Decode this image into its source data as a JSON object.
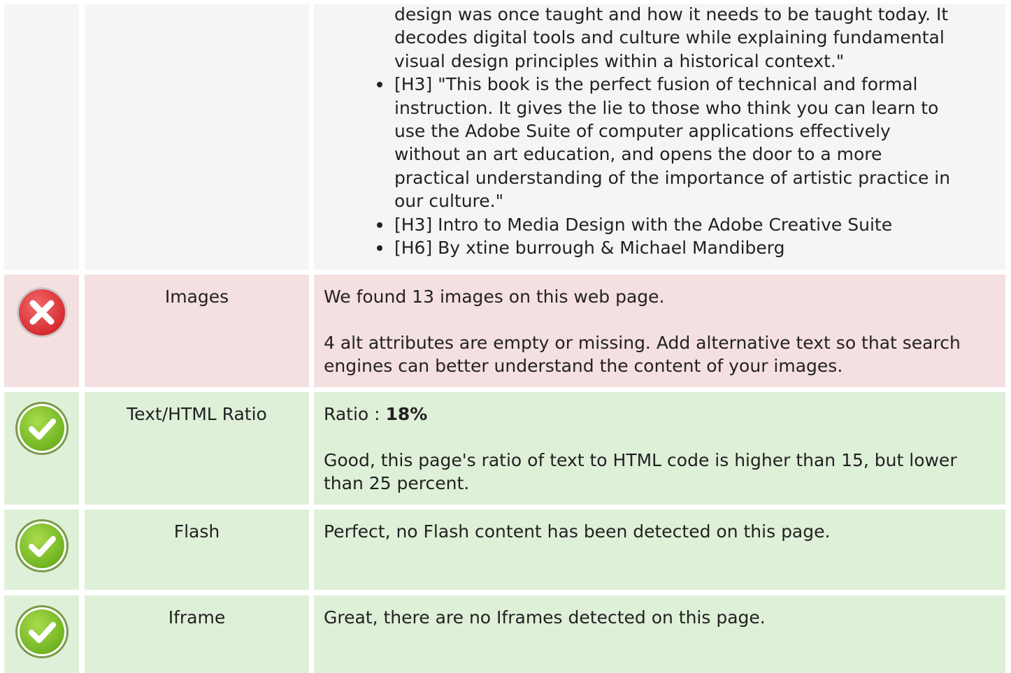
{
  "headings_list": {
    "items": [
      {
        "lines": [
          "design was once taught and how it needs to be taught today. It",
          "decodes digital tools and culture while explaining fundamental",
          "visual design principles within a historical context.\""
        ],
        "bullet": false
      },
      {
        "lines": [
          "[H3] \"This book is the perfect fusion of technical and formal",
          "instruction. It gives the lie to those who think you can learn to",
          "use the Adobe Suite of computer applications effectively",
          "without an art education, and opens the door to a more",
          "practical understanding of the importance of artistic practice in",
          "our culture.\""
        ],
        "bullet": true
      },
      {
        "lines": [
          "[H3] Intro to Media Design with the Adobe Creative Suite"
        ],
        "bullet": true
      },
      {
        "lines": [
          "[H6] By xtine burrough & Michael Mandiberg"
        ],
        "bullet": true
      }
    ]
  },
  "rows": {
    "images": {
      "status": "error",
      "icon": "error-x-icon",
      "label": "Images",
      "p1": "We found 13 images on this web page.",
      "p2": "4 alt attributes are empty or missing. Add alternative text so that search engines can better understand the content of your images."
    },
    "ratio": {
      "status": "pass",
      "icon": "check-icon",
      "label": "Text/HTML Ratio",
      "ratio_prefix": "Ratio : ",
      "ratio_value": "18%",
      "p2": "Good, this page's ratio of text to HTML code is higher than 15, but lower than 25 percent."
    },
    "flash": {
      "status": "pass",
      "icon": "check-icon",
      "label": "Flash",
      "p1": "Perfect, no Flash content has been detected on this page."
    },
    "iframe": {
      "status": "pass",
      "icon": "check-icon",
      "label": "Iframe",
      "p1": "Great, there are no Iframes detected on this page."
    }
  },
  "colors": {
    "neutral_bg": "#f5f5f5",
    "error_bg": "#f4dfe1",
    "pass_bg": "#dff0d8",
    "error_icon": "#e0393e",
    "pass_icon": "#7cc22a"
  }
}
